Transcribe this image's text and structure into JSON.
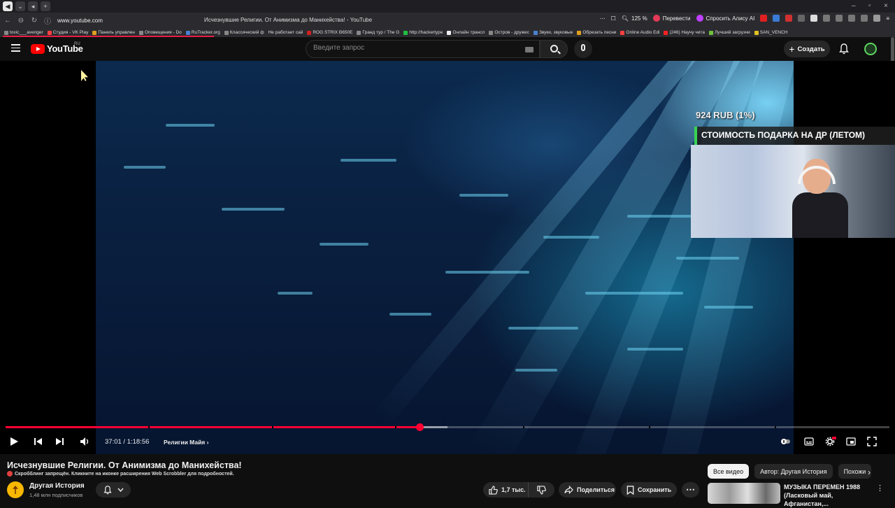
{
  "browser": {
    "url": "www.youtube.com",
    "tab_title": "Исчезнувшие Религии. От Анимизма до Манихейства! - YouTube",
    "zoom": "125 %",
    "translate_label": "Перевести",
    "alice_label": "Спросить Алису AI",
    "bookmarks": [
      "toxic___avenger",
      "Студия - VK Play",
      "Панель управлен",
      "Оповещения - Do",
      "RuTracker.org",
      "Классический ф",
      "Не работает сай",
      "ROG STRIX B650E",
      "Гранд тур / The G",
      "http://hackertype",
      "Онлайн трансл",
      "Остров - дружес",
      "Звуки, звуковые",
      "Обрезать песни",
      "Online Audio Edi",
      "(246) Научу чита",
      "Лучший загрузчи",
      "SAN_VENCH"
    ]
  },
  "header": {
    "logo_text": "YouTube",
    "region": "RU",
    "search_placeholder": "Введите запрос",
    "create_label": "Создать"
  },
  "overlay": {
    "amount": "924 RUB (1%)",
    "banner": "СТОИМОСТЬ ПОДАРКА НА ДР (ЛЕТОМ)"
  },
  "player": {
    "current_time": "37:01",
    "separator": " / ",
    "duration": "1:18:56",
    "chapter": "Религии Майя",
    "progress_played": 0.4685,
    "progress_loaded": 0.5
  },
  "video": {
    "title": "Исчезнувшие Религии. От Анимизма до Манихейства!",
    "scrobble_note": "Скробблинг запрещён. Кликните на иконке расширения Web Scrobbler для подробностей."
  },
  "channel": {
    "name": "Другая История",
    "subscribers": "1,48 млн подписчиков"
  },
  "actions": {
    "likes": "1,7 тыс.",
    "share": "Поделиться",
    "save": "Сохранить"
  },
  "filters": [
    "Все видео",
    "Автор: Другая История",
    "Похожи"
  ],
  "recommendation": {
    "title": "МУЗЫКА ПЕРЕМЕН 1988 (Ласковый май, Афганистан,..."
  },
  "colors": {
    "accent": "#ff0033",
    "overlay_border": "#39d353"
  }
}
